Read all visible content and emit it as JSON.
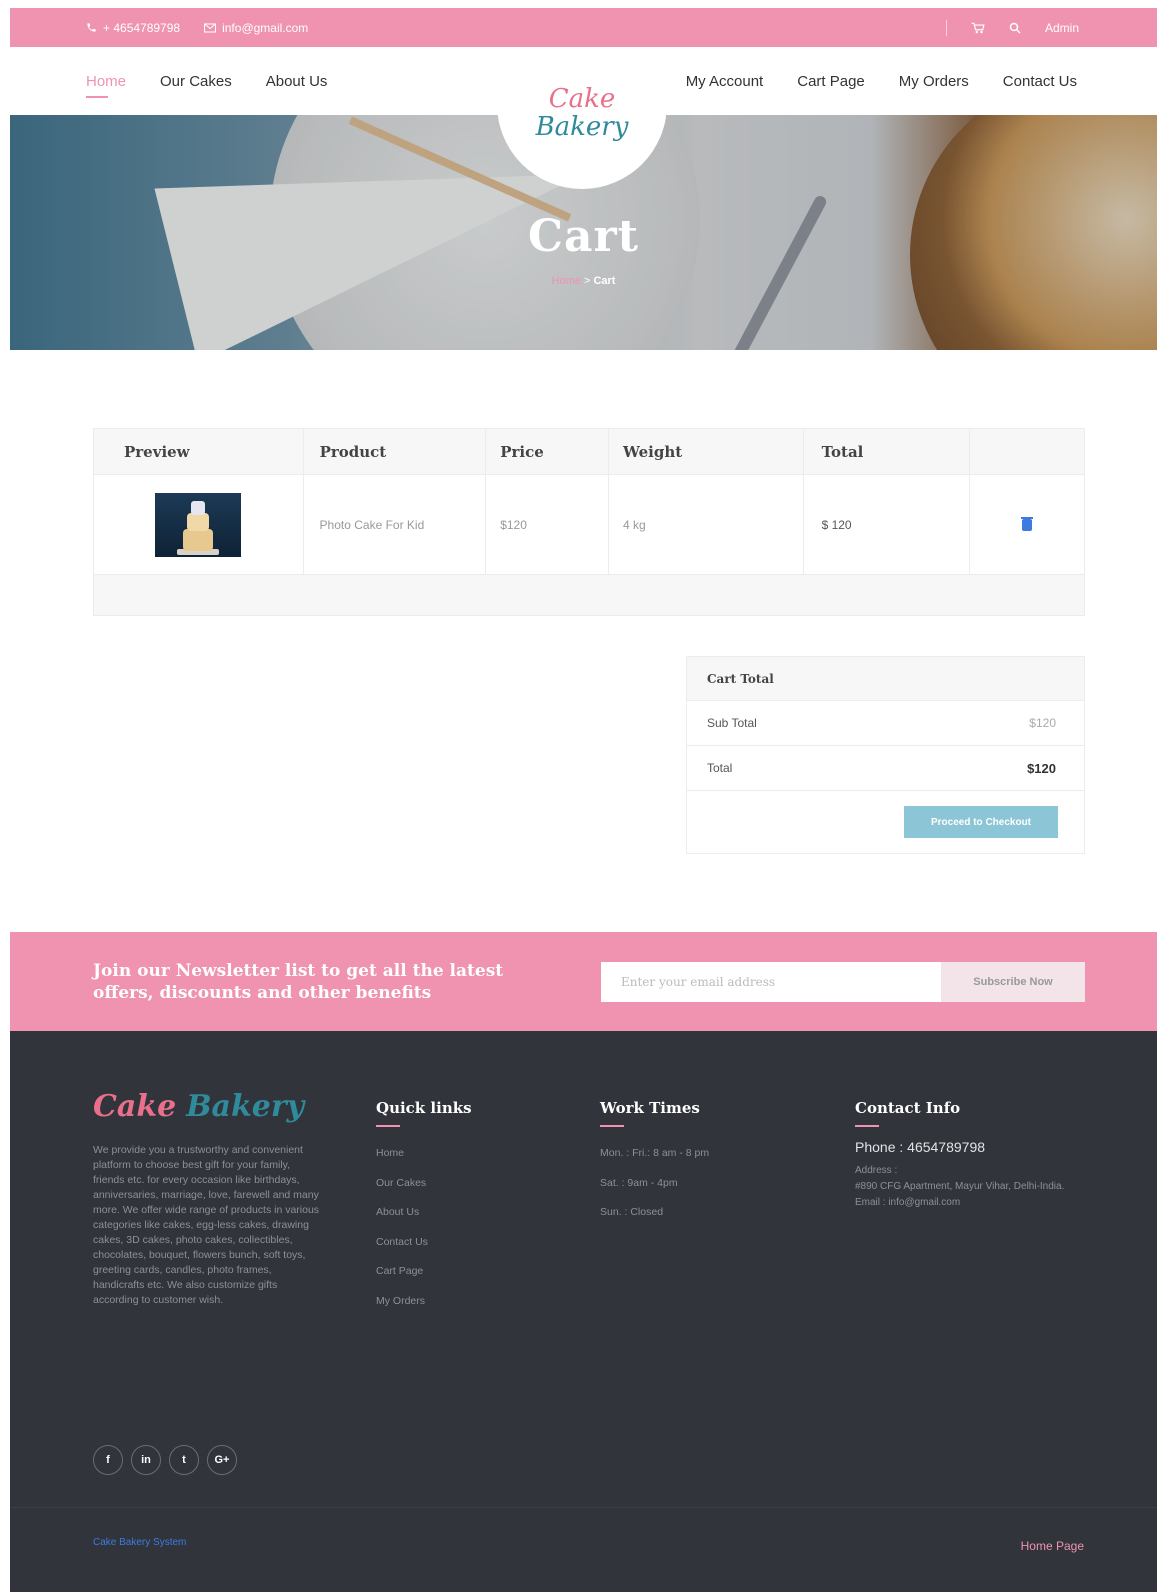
{
  "topbar": {
    "phone": "+ 4654789798",
    "email": "info@gmail.com",
    "user": "Admin"
  },
  "nav": {
    "left": [
      "Home",
      "Our Cakes",
      "About Us"
    ],
    "right": [
      "My Account",
      "Cart Page",
      "My Orders",
      "Contact Us"
    ],
    "logo_top": "Cake",
    "logo_bottom": "Bakery"
  },
  "hero": {
    "title": "Cart",
    "breadcrumb_home": "Home",
    "breadcrumb_sep": ">",
    "breadcrumb_current": "Cart"
  },
  "cart": {
    "headers": [
      "Preview",
      "Product",
      "Price",
      "Weight",
      "Total"
    ],
    "items": [
      {
        "product": "Photo Cake For Kid",
        "price": "$120",
        "weight": "4 kg",
        "total": "$ 120"
      }
    ]
  },
  "cart_total": {
    "title": "Cart Total",
    "subtotal_label": "Sub Total",
    "subtotal_value": "$120",
    "total_label": "Total",
    "total_value": "$120",
    "checkout_label": "Proceed to Checkout"
  },
  "newsletter": {
    "text": "Join our Newsletter list to get all the latest offers, discounts and other benefits",
    "placeholder": "Enter your email address",
    "button": "Subscribe Now"
  },
  "footer": {
    "logo_a": "Cake",
    "logo_b": "Bakery",
    "about": "We provide you a trustworthy and convenient platform to choose best gift for your family, friends etc. for every occasion like birthdays, anniversaries, marriage, love, farewell and many more. We offer wide range of products in various categories like cakes, egg-less cakes, drawing cakes, 3D cakes, photo cakes, collectibles, chocolates, bouquet, flowers bunch, soft toys, greeting cards, candles, photo frames, handicrafts etc. We also customize gifts according to customer wish.",
    "quick_links_title": "Quick links",
    "quick_links": [
      "Home",
      "Our Cakes",
      "About Us",
      "Contact Us",
      "Cart Page",
      "My Orders"
    ],
    "work_title": "Work Times",
    "work_times": [
      "Mon. : Fri.: 8 am - 8 pm",
      "Sat. : 9am - 4pm",
      "Sun. : Closed"
    ],
    "contact_title": "Contact Info",
    "phone": "Phone : 4654789798",
    "address_label": "Address :",
    "address": "#890 CFG Apartment, Mayur Vihar, Delhi-India.",
    "email": "Email : info@gmail.com",
    "socials": [
      "f",
      "in",
      "t",
      "G+"
    ],
    "copyright": "Cake Bakery System",
    "home_link": "Home Page"
  },
  "colors": {
    "accent": "#f093b0",
    "footer_bg": "#31343b",
    "button": "#8cc5d6"
  }
}
